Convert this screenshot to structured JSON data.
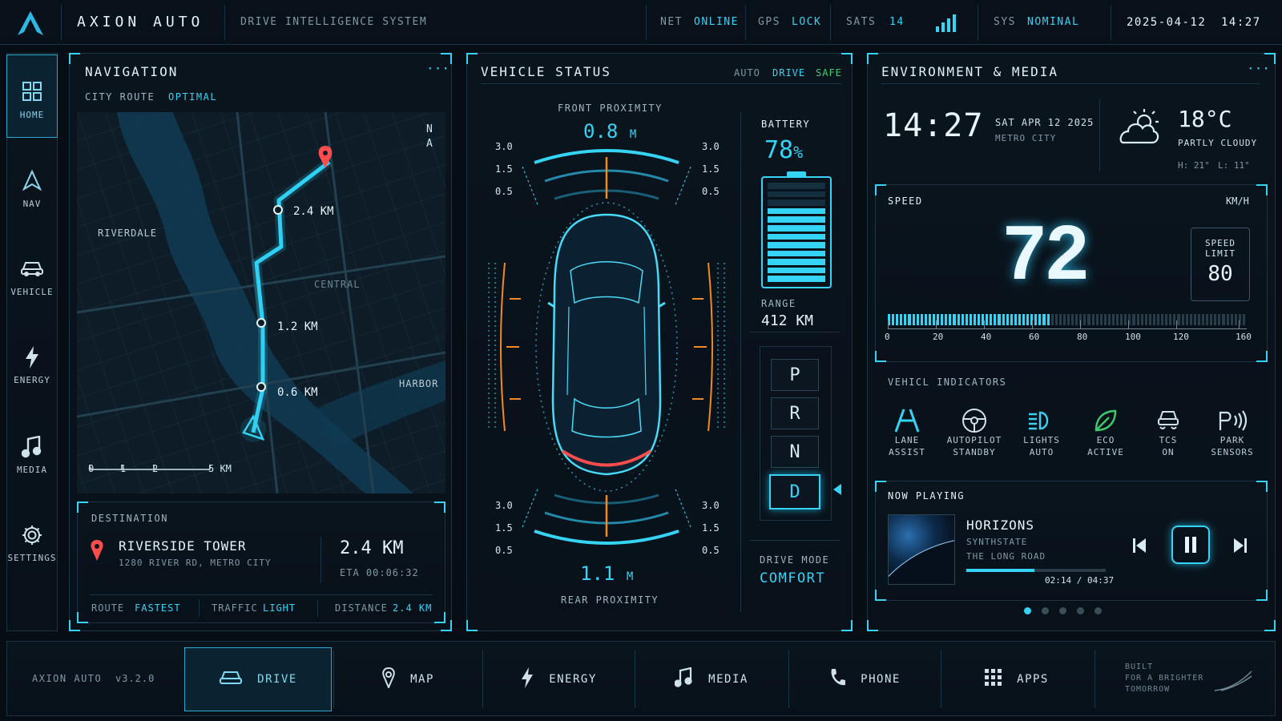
{
  "app": {
    "name": "AXION AUTO",
    "subtitle": "DRIVE INTELLIGENCE SYSTEM"
  },
  "status_bar": {
    "net_label": "NET",
    "net_value": "ONLINE",
    "gps_label": "GPS",
    "gps_value": "LOCK",
    "sats_label": "SATS",
    "sats_value": "14",
    "sys_label": "SYS",
    "sys_value": "NOMINAL",
    "date": "2025-04-12",
    "time": "14:27"
  },
  "sidebar": [
    {
      "label": "HOME",
      "icon": "home-grid-icon"
    },
    {
      "label": "NAV",
      "icon": "nav-arrow-icon"
    },
    {
      "label": "VEHICLE",
      "icon": "car-icon"
    },
    {
      "label": "ENERGY",
      "icon": "bolt-icon"
    },
    {
      "label": "MEDIA",
      "icon": "music-note-icon"
    },
    {
      "label": "SETTINGS",
      "icon": "gear-icon"
    }
  ],
  "navigation": {
    "title": "NAVIGATION",
    "more": "···",
    "route_label": "CITY ROUTE",
    "route_value": "OPTIMAL",
    "compass_n": "N",
    "compass_a": "A",
    "districts": [
      "RIVERDALE",
      "CENTRAL",
      "HARBOR"
    ],
    "waypoints": [
      "2.4 KM",
      "1.2 KM",
      "0.6 KM"
    ],
    "scale_ticks": [
      "0",
      "1",
      "2",
      "5 KM"
    ],
    "destination": {
      "label": "DESTINATION",
      "name": "RIVERSIDE TOWER",
      "address": "1280 RIVER RD, METRO CITY",
      "distance": "2.4 KM",
      "eta": "ETA 00:06:32",
      "route_label": "ROUTE",
      "route_value": "FASTEST",
      "traffic_label": "TRAFFIC",
      "traffic_value": "LIGHT",
      "distance_label": "DISTANCE",
      "distance_value": "2.4 KM"
    }
  },
  "vehicle_status": {
    "title": "VEHICLE STATUS",
    "badges": [
      "AUTO",
      "DRIVE",
      "SAFE"
    ],
    "front_label": "FRONT PROXIMITY",
    "front_value": "0.8",
    "rear_label": "REAR PROXIMITY",
    "rear_value": "1.1",
    "unit": "M",
    "scale": [
      "3.0",
      "1.5",
      "0.5"
    ],
    "battery_label": "BATTERY",
    "battery_value": "78",
    "battery_unit": "%",
    "battery_fraction": 0.78,
    "range_label": "RANGE",
    "range_value": "412 KM",
    "gears": [
      "P",
      "R",
      "N",
      "D"
    ],
    "active_gear": "D",
    "drive_mode_label": "DRIVE MODE",
    "drive_mode_value": "COMFORT"
  },
  "environment": {
    "title": "ENVIRONMENT & MEDIA",
    "more": "···",
    "clock": "14:27",
    "date": "SAT APR 12 2025",
    "city": "METRO CITY",
    "weather_icon": "partly-cloudy-icon",
    "temp": "18°C",
    "condition": "PARTLY CLOUDY",
    "high": "H: 21°",
    "low": "L: 11°"
  },
  "speed": {
    "label": "SPEED",
    "unit": "KM/H",
    "value": "72",
    "value_num": 72,
    "max": 160,
    "limit_label_1": "SPEED",
    "limit_label_2": "LIMIT",
    "limit_value": "80",
    "scale": [
      "0",
      "20",
      "40",
      "60",
      "80",
      "100",
      "120",
      "160"
    ]
  },
  "indicators": {
    "label": "VEHICL  INDICATORS",
    "items": [
      {
        "line1": "LANE",
        "line2": "ASSIST",
        "icon": "lane-assist-icon"
      },
      {
        "line1": "AUTOPILOT",
        "line2": "STANDBY",
        "icon": "steering-wheel-icon"
      },
      {
        "line1": "LIGHTS",
        "line2": "AUTO",
        "icon": "headlight-icon"
      },
      {
        "line1": "ECO",
        "line2": "ACTIVE",
        "icon": "leaf-icon"
      },
      {
        "line1": "TCS",
        "line2": "ON",
        "icon": "traction-control-icon"
      },
      {
        "line1": "PARK",
        "line2": "SENSORS",
        "icon": "park-sensor-icon"
      }
    ]
  },
  "now_playing": {
    "label": "NOW PLAYING",
    "title": "HORIZONS",
    "artist": "SYNTHSTATE",
    "album": "THE LONG ROAD",
    "time": "02:14 / 04:37",
    "progress": 0.49,
    "pages": 5,
    "active_page": 1
  },
  "bottom_bar": {
    "brand": "AXION AUTO",
    "version": "v3.2.0",
    "tabs": [
      {
        "label": "DRIVE",
        "icon": "car-icon"
      },
      {
        "label": "MAP",
        "icon": "map-pin-icon"
      },
      {
        "label": "ENERGY",
        "icon": "bolt-icon"
      },
      {
        "label": "MEDIA",
        "icon": "music-note-icon"
      },
      {
        "label": "PHONE",
        "icon": "phone-icon"
      },
      {
        "label": "APPS",
        "icon": "apps-grid-icon"
      }
    ],
    "tagline_1": "BUILT",
    "tagline_2": "FOR A BRIGHTER",
    "tagline_3": "TOMORROW"
  },
  "colors": {
    "accent": "#35d3f5",
    "route": "#2fd0f3",
    "warning": "#f08a24",
    "destination": "#ff4d4d",
    "eco": "#3ecb6e"
  }
}
